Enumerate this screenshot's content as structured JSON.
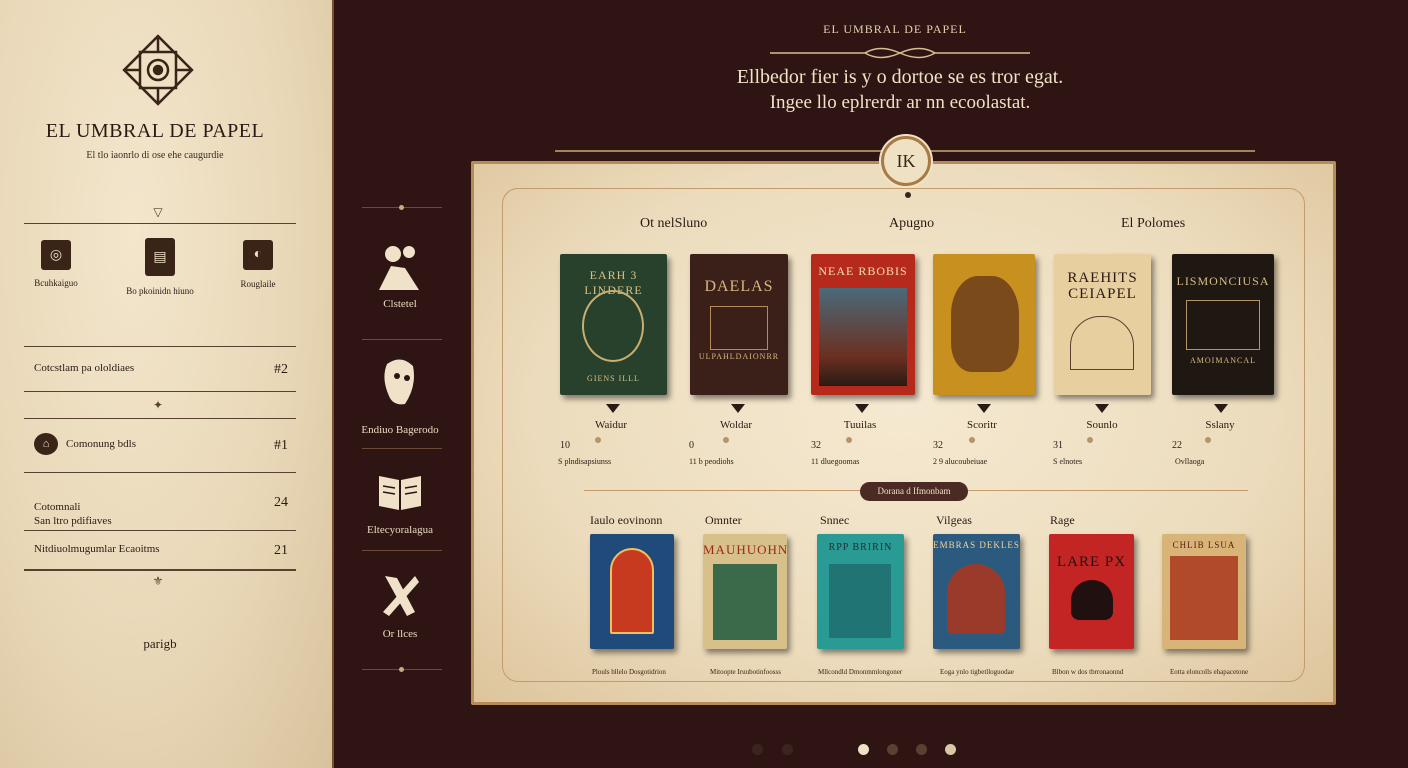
{
  "sidebar": {
    "brand": "EL UMBRAL DE PAPEL",
    "tagline": "El tlo iaonrlo di ose ehe caugurdie",
    "quick": [
      {
        "label": "Bcuhkaiguo",
        "icon": "headphones-icon"
      },
      {
        "label": "Bo pkoinidn hiuno",
        "icon": "book-icon"
      },
      {
        "label": "Rouglaile",
        "icon": "vase-icon"
      }
    ],
    "rows": [
      {
        "label": "Cotcstlam pa ololdiaes",
        "value": "#2"
      },
      {
        "label": "Comonung bdls",
        "value": "#1"
      },
      {
        "label": "Cotomnali\nSan ltro pdifiaves",
        "value": "24"
      },
      {
        "label": "Nitdiuolmugumlar Ecaoitms",
        "value": "21"
      }
    ],
    "footer_link": "parigb"
  },
  "nav": [
    {
      "label": "Clstetel",
      "icon": "readers-icon"
    },
    {
      "label": "Endiuo Bagerodo",
      "icon": "mask-icon"
    },
    {
      "label": "Eltecyoralagua",
      "icon": "open-book-icon"
    },
    {
      "label": "Or llces",
      "icon": "quill-icon"
    }
  ],
  "header": {
    "kicker": "EL UMBRAL DE PAPEL",
    "line1": "Ellbedor fier is y o dortoe se es tror egat.",
    "line2": "Ingee llo eplrerdr ar nn ecoolastat.",
    "medallion": "IK"
  },
  "featured": {
    "columns": [
      "Ot nelSluno",
      "Apugno",
      "El Polomes"
    ],
    "books": [
      {
        "title": "EARH 3 LINDERE",
        "subtitle": "GIENS ILLL",
        "name": "Waidur",
        "count": "10",
        "meta": "S plndisapsiunss",
        "bg": "#27412c",
        "fg": "#d8c086"
      },
      {
        "title": "DAELAS",
        "subtitle": "ULPAHLDAIONRR",
        "name": "Woldar",
        "count": "0",
        "meta": "11 b peodiohs",
        "bg": "#3a2018",
        "fg": "#d7b780"
      },
      {
        "title": "NEAE RBOBIS",
        "subtitle": "",
        "name": "Tuuilas",
        "count": "32",
        "meta": "11 dluegoomas",
        "bg": "#b62a1c",
        "fg": "#f4e0b0"
      },
      {
        "title": "",
        "subtitle": "",
        "name": "Scoritr",
        "count": "32",
        "meta": "2 9 alucoubeiuae",
        "bg": "#c7901f",
        "fg": "#4a2a10"
      },
      {
        "title": "RAEHITS CEIAPEL",
        "subtitle": "",
        "name": "Sounlo",
        "count": "31",
        "meta": "S elnotes",
        "bg": "#e8cfa0",
        "fg": "#2a1a14"
      },
      {
        "title": "LISMONCIUSA",
        "subtitle": "AMOIMANCAL",
        "name": "Sslany",
        "count": "22",
        "meta": "Ovllaoga",
        "bg": "#1e1712",
        "fg": "#d8bd86"
      }
    ]
  },
  "section_pill": "Dorana d Ifmonbam",
  "secondary": {
    "columns": [
      "Iaulo eovinonn",
      "Omnter",
      "Snnec",
      "Vilgeas",
      "Rage"
    ],
    "books": [
      {
        "title": "",
        "meta": "Plouls bllelo Dosgotidrion",
        "bg": "#1f4a7a",
        "fg": "#f0c060"
      },
      {
        "title": "MAUHUOHNA",
        "meta": "Mitoopte Iruubotinfoosss",
        "bg": "#d8c08a",
        "fg": "#9a2a18"
      },
      {
        "title": "RPP BRIRIN",
        "meta": "Mllcondld Dmonmmlongoner",
        "bg": "#2a9a94",
        "fg": "#20302e"
      },
      {
        "title": "EMBRAS DEKLES",
        "meta": "Eoga ynlo tigbetlloguodae",
        "bg": "#2c5a7e",
        "fg": "#f3d3a0"
      },
      {
        "title": "LARE PX",
        "meta": "Blbon w dos tbrronaonnd",
        "bg": "#c32424",
        "fg": "#201010"
      },
      {
        "title": "CHLIB LSUA",
        "meta": "Eotta eloncolls ehapacetone",
        "bg": "#d8b478",
        "fg": "#5a2010"
      }
    ]
  },
  "pager": {
    "count": 6,
    "active": 2
  }
}
